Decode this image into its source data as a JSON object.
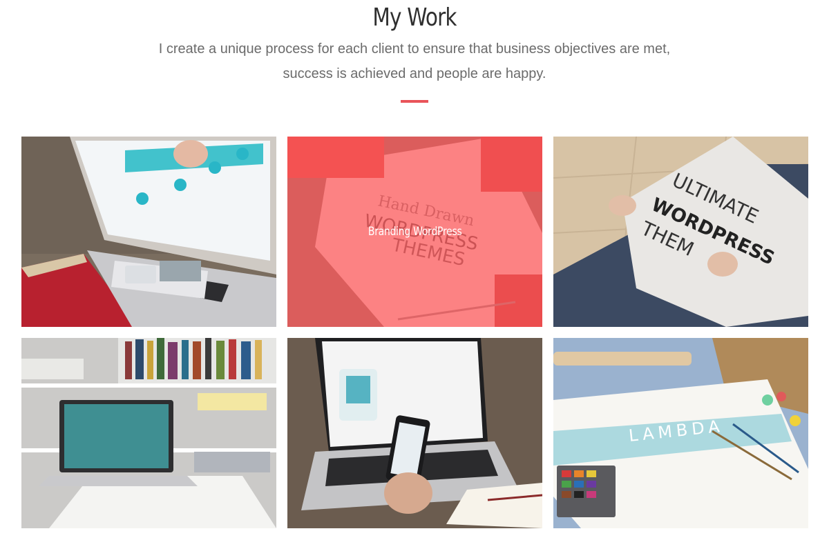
{
  "section": {
    "title": "My Work",
    "subtitle_line1": "I create a unique process for each client to ensure that business objectives are met,",
    "subtitle_line2": "success is achieved and people are happy.",
    "accent_color": "#e9545a"
  },
  "portfolio": {
    "items": [
      {
        "hover_title": "",
        "icon": "laptop-phone-photo"
      },
      {
        "hover_title": "Branding WordPress",
        "icon": "hand-drawn-sketch-photo",
        "hovered": true
      },
      {
        "hover_title": "",
        "icon": "drawing-board-photo",
        "text": "ULTIMATE WORDPRESS THEME"
      },
      {
        "hover_title": "",
        "icon": "laptop-bookshelf-photo"
      },
      {
        "hover_title": "",
        "icon": "laptop-notebook-photo"
      },
      {
        "hover_title": "",
        "icon": "watercolor-paper-photo",
        "text": "LAMBDA"
      }
    ]
  }
}
